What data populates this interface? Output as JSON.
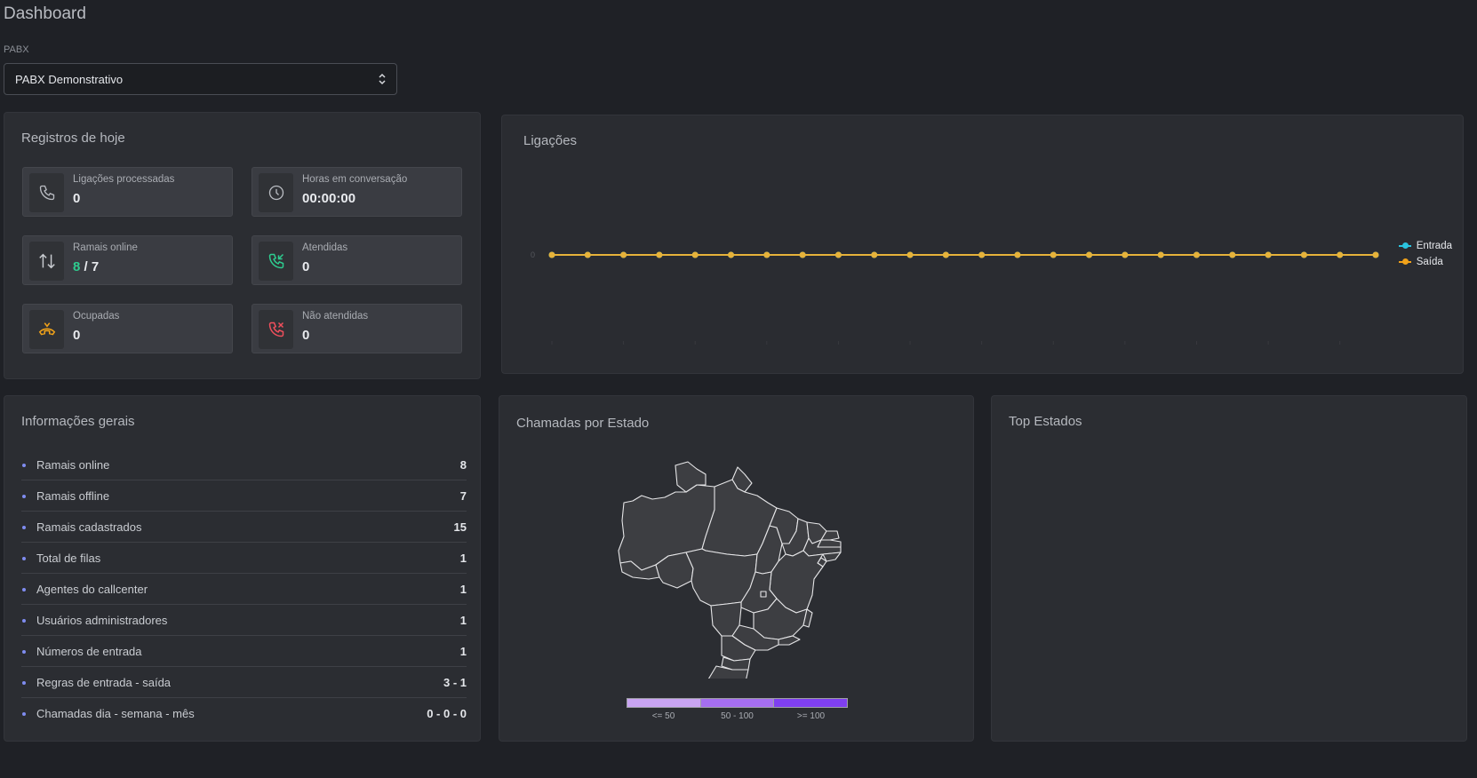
{
  "page": {
    "title": "Dashboard"
  },
  "pabx": {
    "label": "PABX",
    "selected": "PABX Demonstrativo"
  },
  "registros": {
    "title": "Registros de hoje",
    "stats": [
      {
        "label": "Ligações processadas",
        "value": "0",
        "icon": "phone-icon"
      },
      {
        "label": "Horas em conversação",
        "value": "00:00:00",
        "icon": "clock-icon"
      },
      {
        "label": "Ramais online",
        "online": "8",
        "sep": " / ",
        "total": "7",
        "icon": "arrows-up-down-icon"
      },
      {
        "label": "Atendidas",
        "value": "0",
        "icon": "incoming-call-icon"
      },
      {
        "label": "Ocupadas",
        "value": "0",
        "icon": "busy-phone-icon"
      },
      {
        "label": "Não atendidas",
        "value": "0",
        "icon": "missed-call-icon"
      }
    ]
  },
  "ligacoes": {
    "title": "Ligações"
  },
  "chart_data": {
    "type": "line",
    "title": "Ligações",
    "x": [
      "",
      "",
      "",
      "",
      "",
      "",
      "",
      "",
      "",
      "",
      "",
      "",
      "",
      "",
      "",
      "",
      "",
      "",
      "",
      "",
      "",
      "",
      "",
      ""
    ],
    "series": [
      {
        "name": "Entrada",
        "color": "#2bc4e0",
        "values": [
          0,
          0,
          0,
          0,
          0,
          0,
          0,
          0,
          0,
          0,
          0,
          0,
          0,
          0,
          0,
          0,
          0,
          0,
          0,
          0,
          0,
          0,
          0,
          0
        ]
      },
      {
        "name": "Saída",
        "color": "#f0a21a",
        "values": [
          0,
          0,
          0,
          0,
          0,
          0,
          0,
          0,
          0,
          0,
          0,
          0,
          0,
          0,
          0,
          0,
          0,
          0,
          0,
          0,
          0,
          0,
          0,
          0
        ]
      }
    ],
    "ylabel_tick": "0",
    "legend": "right",
    "grid": false
  },
  "info": {
    "title": "Informações gerais",
    "items": [
      {
        "label": "Ramais online",
        "value": "8",
        "color": "green"
      },
      {
        "label": "Ramais offline",
        "value": "7",
        "color": "red"
      },
      {
        "label": "Ramais cadastrados",
        "value": "15"
      },
      {
        "label": "Total de filas",
        "value": "1"
      },
      {
        "label": "Agentes do callcenter",
        "value": "1"
      },
      {
        "label": "Usuários administradores",
        "value": "1"
      },
      {
        "label": "Números de entrada",
        "value": "1"
      },
      {
        "label": "Regras de entrada - saída",
        "value": "3 - 1"
      },
      {
        "label": "Chamadas dia - semana - mês",
        "value": "0 - 0 - 0"
      }
    ]
  },
  "estado": {
    "title": "Chamadas por Estado",
    "scale": [
      {
        "label": "<= 50",
        "color": "#c9a4f2"
      },
      {
        "label": "50 - 100",
        "color": "#a56ef0"
      },
      {
        "label": ">= 100",
        "color": "#7f3ff0"
      }
    ]
  },
  "top": {
    "title": "Top Estados"
  }
}
